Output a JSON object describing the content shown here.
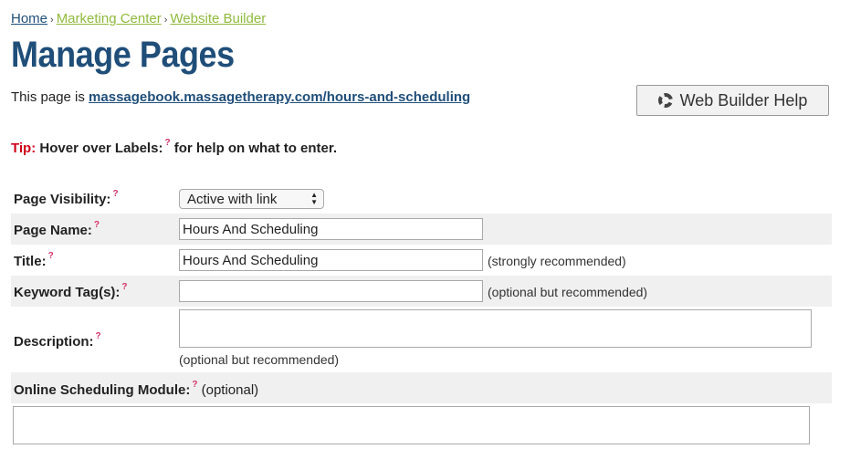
{
  "breadcrumb": {
    "home": "Home",
    "separator": "›",
    "marketing_center": "Marketing Center",
    "website_builder": "Website Builder"
  },
  "page_title": "Manage Pages",
  "page_url": {
    "prefix": "This page is",
    "url": "massagebook.massagetherapy.com/hours-and-scheduling"
  },
  "help_button": {
    "label": "Web Builder Help",
    "icon": "lifebuoy-icon"
  },
  "tip": {
    "label": "Tip:",
    "text_before": "Hover over Labels:",
    "marker": "?",
    "text_after": "for help on what to enter."
  },
  "form": {
    "help_marker": "?",
    "visibility": {
      "label": "Page Visibility:",
      "value": "Active with link"
    },
    "page_name": {
      "label": "Page Name:",
      "value": "Hours And Scheduling"
    },
    "title": {
      "label": "Title:",
      "value": "Hours And Scheduling",
      "note": "(strongly recommended)"
    },
    "keywords": {
      "label": "Keyword Tag(s):",
      "value": "",
      "note": "(optional but recommended)"
    },
    "description": {
      "label": "Description:",
      "value": "",
      "note": "(optional but recommended)"
    },
    "scheduling": {
      "label": "Online Scheduling Module:",
      "note": "(optional)",
      "value": ""
    }
  },
  "colors": {
    "brand_blue": "#1f4e79",
    "breadcrumb_green": "#8fba3c",
    "tip_red": "#d0021b",
    "help_marker_pink": "#d6336c",
    "row_shade": "#f0f0f0"
  }
}
